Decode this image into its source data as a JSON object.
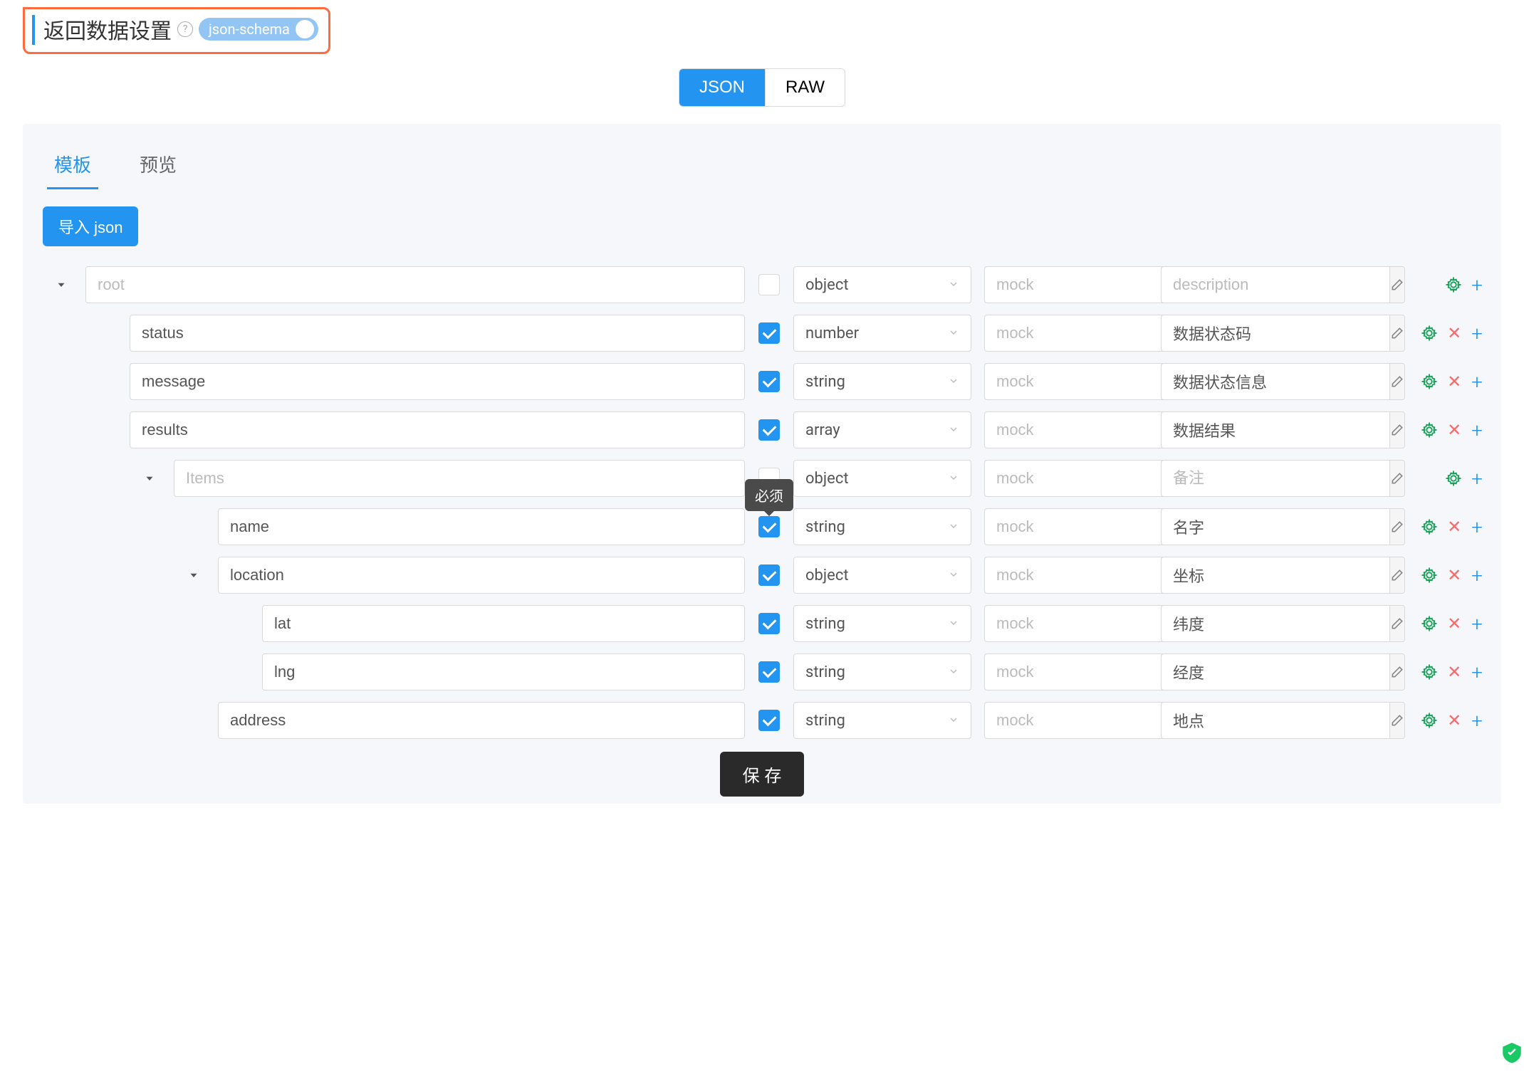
{
  "header": {
    "title": "返回数据设置",
    "toggle_label": "json-schema"
  },
  "view_toggle": {
    "json": "JSON",
    "raw": "RAW"
  },
  "tabs": {
    "template": "模板",
    "preview": "预览"
  },
  "import_btn": "导入 json",
  "tooltip_required": "必须",
  "placeholders": {
    "mock": "mock",
    "description": "description",
    "remark": "备注",
    "items": "Items"
  },
  "rows": [
    {
      "indent": 0,
      "caret": true,
      "name": "root",
      "name_disabled": true,
      "checked": null,
      "type": "object",
      "desc": "",
      "desc_ph": "description",
      "show_del": false
    },
    {
      "indent": 1,
      "caret": false,
      "name": "status",
      "checked": true,
      "type": "number",
      "desc": "数据状态码",
      "show_del": true
    },
    {
      "indent": 1,
      "caret": false,
      "name": "message",
      "checked": true,
      "type": "string",
      "desc": "数据状态信息",
      "show_del": true
    },
    {
      "indent": 1,
      "caret": false,
      "name": "results",
      "checked": true,
      "type": "array",
      "desc": "数据结果",
      "show_del": true
    },
    {
      "indent": 2,
      "caret": true,
      "name": "",
      "name_ph": "Items",
      "name_disabled": true,
      "checked": null,
      "type": "object",
      "desc": "",
      "desc_ph": "备注",
      "show_del": false
    },
    {
      "indent": 3,
      "caret": false,
      "name": "name",
      "checked": true,
      "tooltip": true,
      "type": "string",
      "desc": "名字",
      "show_del": true
    },
    {
      "indent": 3,
      "caret": true,
      "name": "location",
      "checked": true,
      "type": "object",
      "desc": "坐标",
      "show_del": true
    },
    {
      "indent": 4,
      "caret": false,
      "name": "lat",
      "checked": true,
      "type": "string",
      "desc": "纬度",
      "show_del": true
    },
    {
      "indent": 4,
      "caret": false,
      "name": "lng",
      "checked": true,
      "type": "string",
      "desc": "经度",
      "show_del": true
    },
    {
      "indent": 3,
      "caret": false,
      "name": "address",
      "checked": true,
      "type": "string",
      "desc": "地点",
      "show_del": true
    }
  ],
  "save_btn": "保 存"
}
